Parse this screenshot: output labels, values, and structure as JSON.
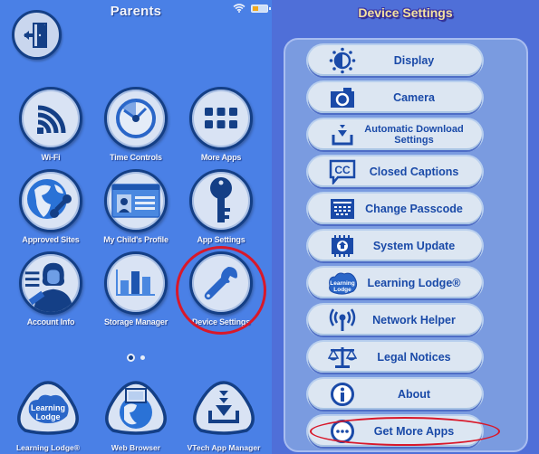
{
  "left": {
    "title": "Parents",
    "status": {
      "wifi": "wifi-icon",
      "battery_level": "low"
    },
    "exit_button": {
      "icon": "exit-door-icon"
    },
    "tiles": [
      {
        "label": "Wi-Fi",
        "icon": "wifi-icon"
      },
      {
        "label": "Time Controls",
        "icon": "clock-icon"
      },
      {
        "label": "More Apps",
        "icon": "grid-icon"
      },
      {
        "label": "Approved Sites",
        "icon": "globe-wrench-icon"
      },
      {
        "label": "My Child's Profile",
        "icon": "id-card-icon"
      },
      {
        "label": "App Settings",
        "icon": "key-icon"
      },
      {
        "label": "Account Info",
        "icon": "account-person-icon"
      },
      {
        "label": "Storage Manager",
        "icon": "bar-chart-icon"
      },
      {
        "label": "Device Settings",
        "icon": "wrench-icon",
        "highlighted": true
      }
    ],
    "pager": {
      "current": 1,
      "total": 2
    },
    "bottom_apps": [
      {
        "label": "Learning Lodge®",
        "icon": "learning-lodge-icon"
      },
      {
        "label": "Web Browser",
        "icon": "web-browser-icon"
      },
      {
        "label": "VTech App Manager",
        "icon": "download-icon"
      }
    ]
  },
  "right": {
    "title": "Device Settings",
    "menu": [
      {
        "label": "Display",
        "icon": "brightness-icon"
      },
      {
        "label": "Camera",
        "icon": "camera-icon"
      },
      {
        "label": "Automatic Download Settings",
        "line1": "Automatic Download",
        "line2": "Settings",
        "icon": "download-tray-icon"
      },
      {
        "label": "Closed Captions",
        "icon": "closed-captions-icon"
      },
      {
        "label": "Change Passcode",
        "icon": "keypad-icon"
      },
      {
        "label": "System Update",
        "icon": "chip-update-icon"
      },
      {
        "label": "Learning Lodge®",
        "icon": "learning-lodge-icon"
      },
      {
        "label": "Network Helper",
        "icon": "antenna-icon"
      },
      {
        "label": "Legal Notices",
        "icon": "scales-icon"
      },
      {
        "label": "About",
        "icon": "info-icon"
      },
      {
        "label": "Get More Apps",
        "icon": "more-dots-icon",
        "highlighted": true
      }
    ]
  },
  "colors": {
    "left_bg": "#4a80e6",
    "right_bg": "#4f6fd8",
    "icon_navy": "#143f86",
    "highlight_red": "#d8182a",
    "title_gold": "#f3e2a0"
  }
}
